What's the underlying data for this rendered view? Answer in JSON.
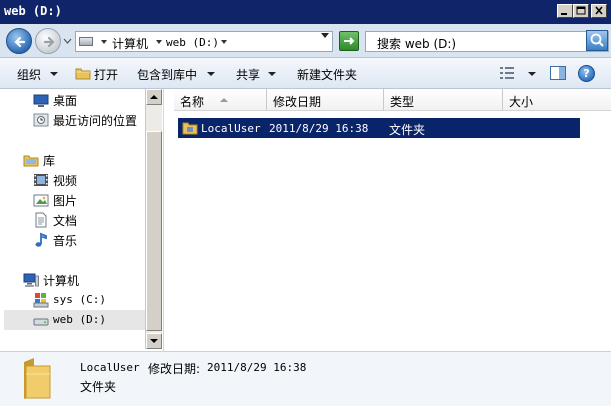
{
  "window": {
    "title": "web (D:)",
    "controls": [
      "minimize",
      "maximize",
      "close"
    ]
  },
  "address_bar": {
    "crumbs": [
      "计算机",
      "web (D:)"
    ],
    "search_placeholder": "搜索 web (D:)"
  },
  "toolbar": {
    "organize": "组织",
    "open": "打开",
    "include_in_library": "包含到库中",
    "share": "共享",
    "new_folder": "新建文件夹",
    "help": "?"
  },
  "nav_pane": {
    "items": [
      {
        "label": "桌面",
        "icon": "desktop-icon"
      },
      {
        "label": "最近访问的位置",
        "icon": "recent-places-icon"
      },
      {
        "label": "库",
        "icon": "libraries-icon"
      },
      {
        "label": "视频",
        "icon": "videos-icon"
      },
      {
        "label": "图片",
        "icon": "pictures-icon"
      },
      {
        "label": "文档",
        "icon": "documents-icon"
      },
      {
        "label": "音乐",
        "icon": "music-icon"
      },
      {
        "label": "计算机",
        "icon": "computer-icon"
      },
      {
        "label": "sys (C:)",
        "icon": "system-drive-icon"
      },
      {
        "label": "web (D:)",
        "icon": "drive-icon",
        "selected": true
      }
    ]
  },
  "file_list": {
    "columns": [
      "名称",
      "修改日期",
      "类型",
      "大小"
    ],
    "rows": [
      {
        "name": "LocalUser",
        "modified": "2011/8/29 16:38",
        "type": "文件夹",
        "size": "",
        "selected": true
      }
    ]
  },
  "details_pane": {
    "name": "LocalUser",
    "modified_label": "修改日期:",
    "modified_value": "2011/8/29 16:38",
    "type": "文件夹"
  },
  "colors": {
    "title_bar": "#10246a",
    "selection": "#0a246a",
    "address_bar": "#d9e4f1",
    "toolbar": "#dde7f3",
    "details_pane": "#f2f6fb"
  }
}
